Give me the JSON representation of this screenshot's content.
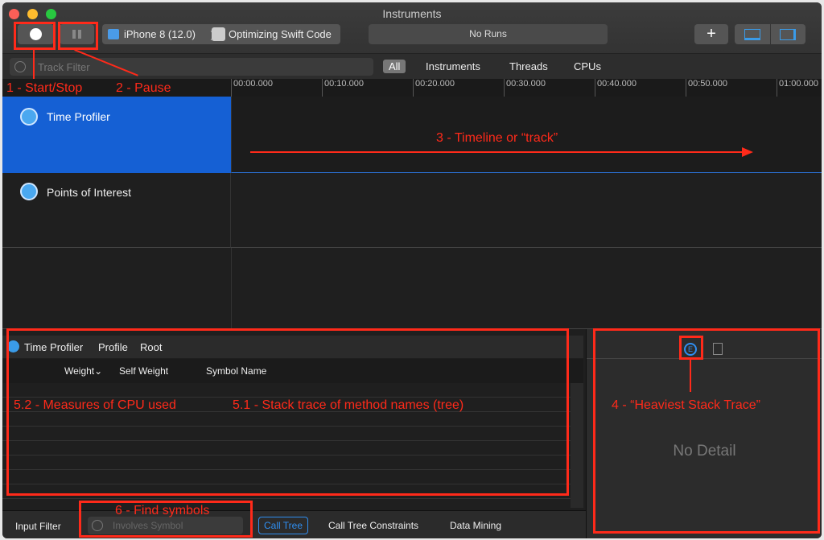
{
  "window": {
    "title": "Instruments"
  },
  "toolbar": {
    "device": "iPhone 8 (12.0)",
    "target": "Optimizing Swift Code",
    "runs": "No Runs",
    "add": "+"
  },
  "filter": {
    "placeholder": "Track Filter",
    "tabs": [
      "All",
      "Instruments",
      "Threads",
      "CPUs"
    ]
  },
  "ruler": [
    "00:00.000",
    "00:10.000",
    "00:20.000",
    "00:30.000",
    "00:40.000",
    "00:50.000",
    "01:00.000"
  ],
  "tracks": [
    {
      "name": "Time Profiler"
    },
    {
      "name": "Points of Interest"
    }
  ],
  "detail": {
    "breadcrumb": [
      "Time Profiler",
      "Profile",
      "Root"
    ],
    "columns": [
      "Weight",
      "Self Weight",
      "Symbol Name"
    ],
    "no_detail": "No Detail"
  },
  "bottom": {
    "input_filter": "Input Filter",
    "placeholder": "Involves Symbol",
    "tabs": [
      "Call Tree",
      "Call Tree Constraints",
      "Data Mining"
    ]
  },
  "annotations": {
    "a1": "1 - Start/Stop",
    "a2": "2 - Pause",
    "a3": "3 - Timeline or “track”",
    "a4": "4 - “Heaviest Stack Trace”",
    "a51": "5.1 - Stack trace of method names (tree)",
    "a52": "5.2 - Measures of CPU used",
    "a6": "6 - Find symbols"
  },
  "colors": {
    "accent": "#1560d4",
    "annotation": "#ff2a1a"
  }
}
